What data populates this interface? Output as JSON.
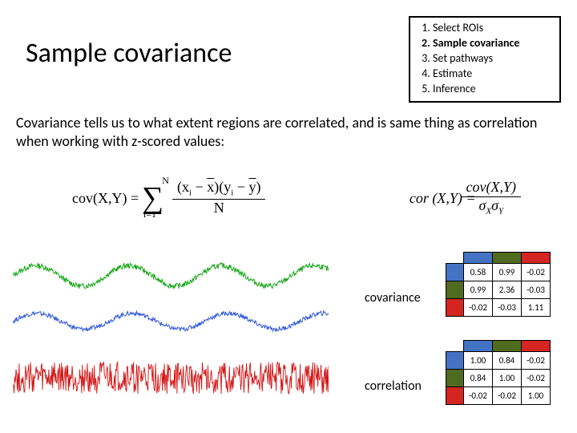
{
  "title": "Sample covariance",
  "steps": [
    {
      "n": "1",
      "label": "Select ROIs",
      "bold": false
    },
    {
      "n": "2",
      "label": "Sample covariance",
      "bold": true
    },
    {
      "n": "3",
      "label": "Set pathways",
      "bold": false
    },
    {
      "n": "4",
      "label": "Estimate",
      "bold": false
    },
    {
      "n": "5",
      "label": "Inference",
      "bold": false
    }
  ],
  "body": "Covariance tells us to what extent regions are correlated, and is same thing as correlation when working with z-scored values:",
  "formulas": {
    "cov_prefix": "cov(X,Y) = ",
    "cov_num": "(xᵢ − x̄)(yᵢ − ȳ)",
    "cov_den": "N",
    "cov_sum_top": "N",
    "cov_sum_bot": "i=1",
    "cor_prefix": "cor (X,Y) = ",
    "cor_num": "cov(X,Y)",
    "cor_den_sx": "σX",
    "cor_den_sy": "σY"
  },
  "labels": {
    "covariance": "covariance",
    "correlation": "correlation"
  },
  "colors": {
    "blue": "#4573c4",
    "green": "#4f6b1f",
    "red": "#d52522"
  },
  "cov_matrix": [
    [
      "0.58",
      "0.99",
      "-0.02"
    ],
    [
      "0.99",
      "2.36",
      "-0.03"
    ],
    [
      "-0.02",
      "-0.03",
      "1.11"
    ]
  ],
  "cor_matrix": [
    [
      "1.00",
      "0.84",
      "-0.02"
    ],
    [
      "0.84",
      "1.00",
      "-0.02"
    ],
    [
      "-0.02",
      "-0.02",
      "1.00"
    ]
  ],
  "chart_data": {
    "type": "line",
    "note": "Three time-series traces stacked vertically (green top, blue middle, red bottom). Values approximate — no y-axis numbers shown in source; x runs ~0..500.",
    "x": [
      0,
      30,
      60,
      90,
      120,
      150,
      180,
      210,
      240,
      270,
      300,
      330,
      360,
      390,
      420,
      450,
      480,
      500
    ],
    "series": [
      {
        "name": "green",
        "baseline": 6,
        "values": [
          6.0,
          6.4,
          6.6,
          6.3,
          5.8,
          6.1,
          6.6,
          6.5,
          6.0,
          5.8,
          6.3,
          6.6,
          6.2,
          5.9,
          6.0,
          6.5,
          6.6,
          6.1
        ]
      },
      {
        "name": "blue",
        "baseline": 4,
        "values": [
          4.0,
          4.3,
          4.5,
          4.2,
          3.9,
          4.1,
          4.5,
          4.4,
          4.0,
          3.9,
          4.2,
          4.5,
          4.1,
          3.9,
          4.0,
          4.4,
          4.5,
          4.0
        ]
      },
      {
        "name": "red",
        "baseline": 1.5,
        "values": [
          1.5,
          2.1,
          1.0,
          1.9,
          1.2,
          2.0,
          1.1,
          1.8,
          1.3,
          2.0,
          1.0,
          1.9,
          1.2,
          2.1,
          1.1,
          1.8,
          1.4,
          1.9
        ]
      }
    ],
    "xlim": [
      0,
      500
    ],
    "ylim": [
      0,
      7.2
    ]
  }
}
